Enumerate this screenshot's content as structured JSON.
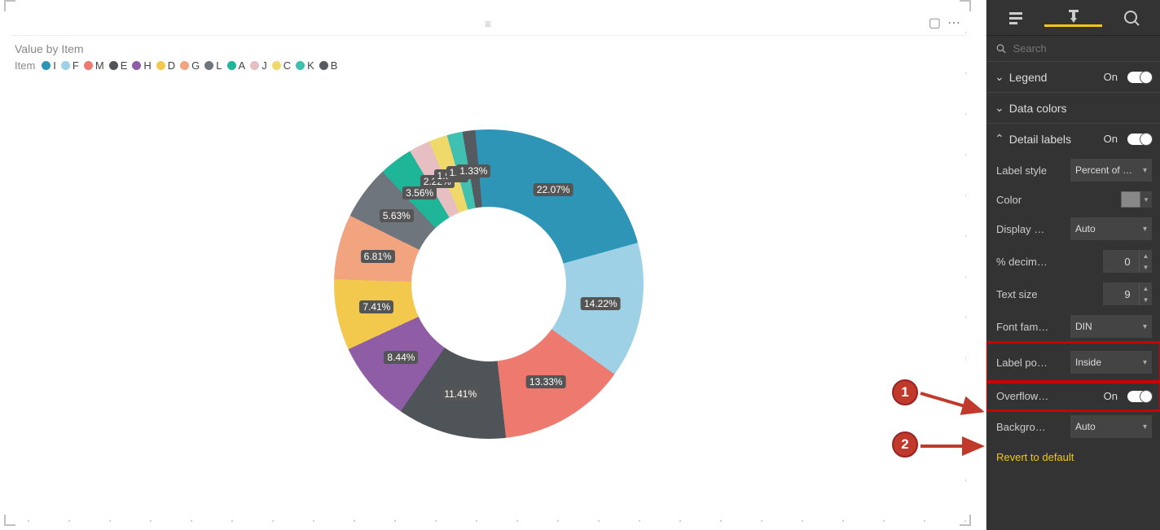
{
  "canvas": {
    "title": "Value by Item",
    "legend_field": "Item",
    "focus_glyph": "▢",
    "more_glyph": "⋯",
    "grip_glyph": "≡"
  },
  "chart_data": {
    "type": "pie",
    "title": "Value by Item",
    "series": [
      {
        "name": "I",
        "value": 22.07,
        "color": "#2E95B6",
        "label": "22.07%"
      },
      {
        "name": "F",
        "value": 14.22,
        "color": "#9ED0E6",
        "label": "14.22%"
      },
      {
        "name": "M",
        "value": 13.33,
        "color": "#ED796F",
        "label": "13.33%"
      },
      {
        "name": "E",
        "value": 11.41,
        "color": "#4F5459",
        "label": "11.41%"
      },
      {
        "name": "H",
        "value": 8.44,
        "color": "#8E5DA6",
        "label": "8.44%"
      },
      {
        "name": "D",
        "value": 7.41,
        "color": "#F2C94C",
        "label": "7.41%"
      },
      {
        "name": "G",
        "value": 6.81,
        "color": "#F2A47E",
        "label": "6.81%"
      },
      {
        "name": "L",
        "value": 5.63,
        "color": "#6E757C",
        "label": "5.63%"
      },
      {
        "name": "A",
        "value": 3.56,
        "color": "#1FB598",
        "label": "3.56%"
      },
      {
        "name": "J",
        "value": 2.22,
        "color": "#E7BEC2",
        "label": "2.22%"
      },
      {
        "name": "C",
        "value": 1.93,
        "color": "#F0D96B",
        "label": "1.93%"
      },
      {
        "name": "K",
        "value": 1.63,
        "color": "#3FC0B0",
        "label": "1.63%"
      },
      {
        "name": "B",
        "value": 1.33,
        "color": "#555A60",
        "label": "1.33%"
      }
    ]
  },
  "panel": {
    "search_placeholder": "Search",
    "sections": {
      "legend": {
        "label": "Legend",
        "state": "On"
      },
      "data_colors": {
        "label": "Data colors"
      },
      "detail_labels": {
        "label": "Detail labels",
        "state": "On"
      }
    },
    "props": {
      "label_style": {
        "label": "Label style",
        "value": "Percent of …"
      },
      "color": {
        "label": "Color",
        "value": "#888888"
      },
      "display_units": {
        "label": "Display …",
        "value": "Auto"
      },
      "pct_decimal": {
        "label": "% decim…",
        "value": "0"
      },
      "text_size": {
        "label": "Text size",
        "value": "9"
      },
      "font_family": {
        "label": "Font fam…",
        "value": "DIN"
      },
      "label_position": {
        "label": "Label po…",
        "value": "Inside"
      },
      "overflow": {
        "label": "Overflow…",
        "state": "On"
      },
      "background": {
        "label": "Backgro…",
        "value": "Auto"
      }
    },
    "revert": "Revert to default"
  },
  "callouts": {
    "one": "1",
    "two": "2"
  }
}
